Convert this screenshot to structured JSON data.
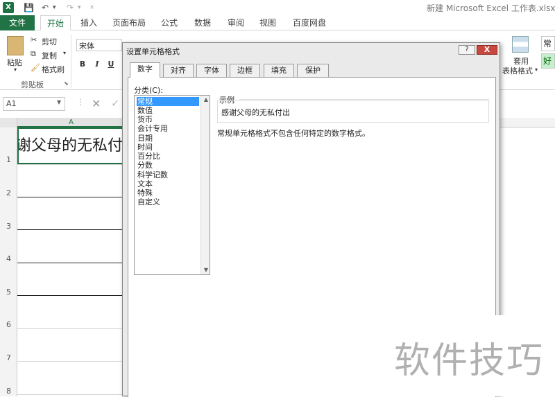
{
  "titlebar": {
    "app_icon": "X",
    "save_icon": "save-icon",
    "undo_icon": "↶",
    "redo_icon": "↷",
    "title": "新建 Microsoft Excel 工作表.xlsx - E"
  },
  "ribbon_tabs": [
    "文件",
    "开始",
    "插入",
    "页面布局",
    "公式",
    "数据",
    "审阅",
    "视图",
    "百度网盘"
  ],
  "ribbon": {
    "paste": "粘贴",
    "cut": "剪切",
    "copy": "复制",
    "format_painter": "格式刷",
    "clipboard_group": "剪贴板",
    "font_name": "宋体",
    "bold": "B",
    "italic": "I",
    "underline": "U",
    "table_format_line1": "套用",
    "table_format_line2": "表格格式",
    "style_normal": "常",
    "style_good": "好"
  },
  "formula_bar": {
    "name_box": "A1"
  },
  "sheet": {
    "column_a": "A",
    "rows": [
      "1",
      "2",
      "3",
      "4",
      "5",
      "6",
      "7",
      "8"
    ],
    "a1_value": "感谢父母的无私付出"
  },
  "dialog": {
    "title": "设置单元格格式",
    "help": "?",
    "close": "X",
    "tabs": [
      "数字",
      "对齐",
      "字体",
      "边框",
      "填充",
      "保护"
    ],
    "active_tab": "数字",
    "category_label": "分类(C):",
    "categories": [
      "常规",
      "数值",
      "货币",
      "会计专用",
      "日期",
      "时间",
      "百分比",
      "分数",
      "科学记数",
      "文本",
      "特殊",
      "自定义"
    ],
    "selected_category": "常规",
    "sample_label": "示例",
    "sample_value": "感谢父母的无私付出",
    "description": "常规单元格格式不包含任何特定的数字格式。"
  },
  "watermark": "软件技巧"
}
